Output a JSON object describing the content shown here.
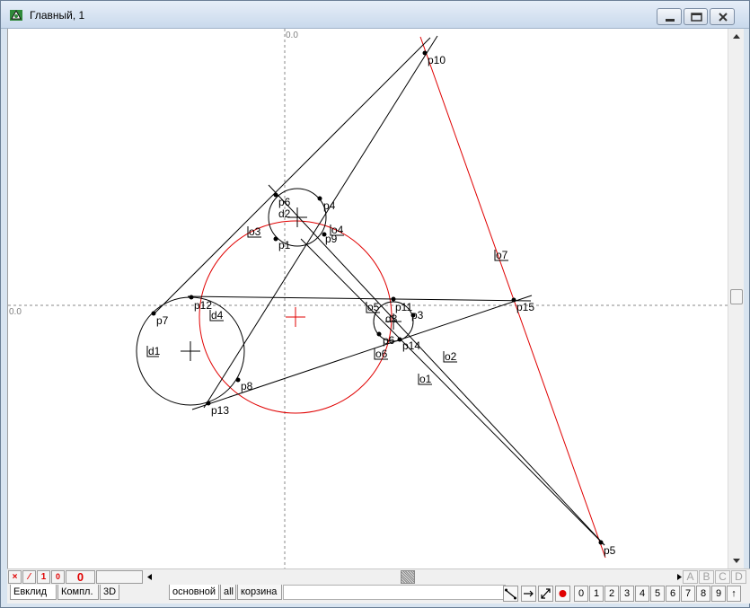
{
  "window": {
    "title": "Главный, 1"
  },
  "axes": {
    "x_origin_label": "0.0",
    "y_origin_label": "0.0"
  },
  "labels": {
    "points": [
      "p1",
      "p3",
      "p4",
      "p5",
      "p6",
      "p7",
      "p8",
      "p9",
      "p10",
      "p11",
      "p12",
      "p13",
      "p14",
      "p15",
      "p6b"
    ],
    "p1": "p1",
    "p3": "p3",
    "p4": "p4",
    "p5": "p5",
    "p6": "p6",
    "p7": "p7",
    "p8": "p8",
    "p9": "p9",
    "p10": "p10",
    "p11": "p11",
    "p12": "p12",
    "p13": "p13",
    "p14": "p14",
    "p15": "p15",
    "p6b": "p6",
    "d1": "d1",
    "d2": "d2",
    "d3": "d3",
    "d4": "d4",
    "o1": "o1",
    "o2": "o2",
    "o3": "o3",
    "o4": "o4",
    "o5": "o5",
    "o6": "o6",
    "o7": "o7"
  },
  "bottom_bar": {
    "clear_label": "×",
    "line_label": "⁄",
    "one_label": "1",
    "zero_small_label": "0",
    "zero_big_label": "0",
    "layers": [
      "A",
      "B",
      "C",
      "D"
    ]
  },
  "tabs": {
    "left": [
      "Евклид",
      "Компл.",
      "3D"
    ],
    "right": [
      "основной",
      "all",
      "корзина"
    ]
  },
  "toolbar": {
    "numbers": [
      "0",
      "1",
      "2",
      "3",
      "4",
      "5",
      "6",
      "7",
      "8",
      "9"
    ],
    "up_label": "↑"
  },
  "colors": {
    "ink": "#000000",
    "accent_red": "#e00000",
    "dash": "#8a8a8a"
  }
}
